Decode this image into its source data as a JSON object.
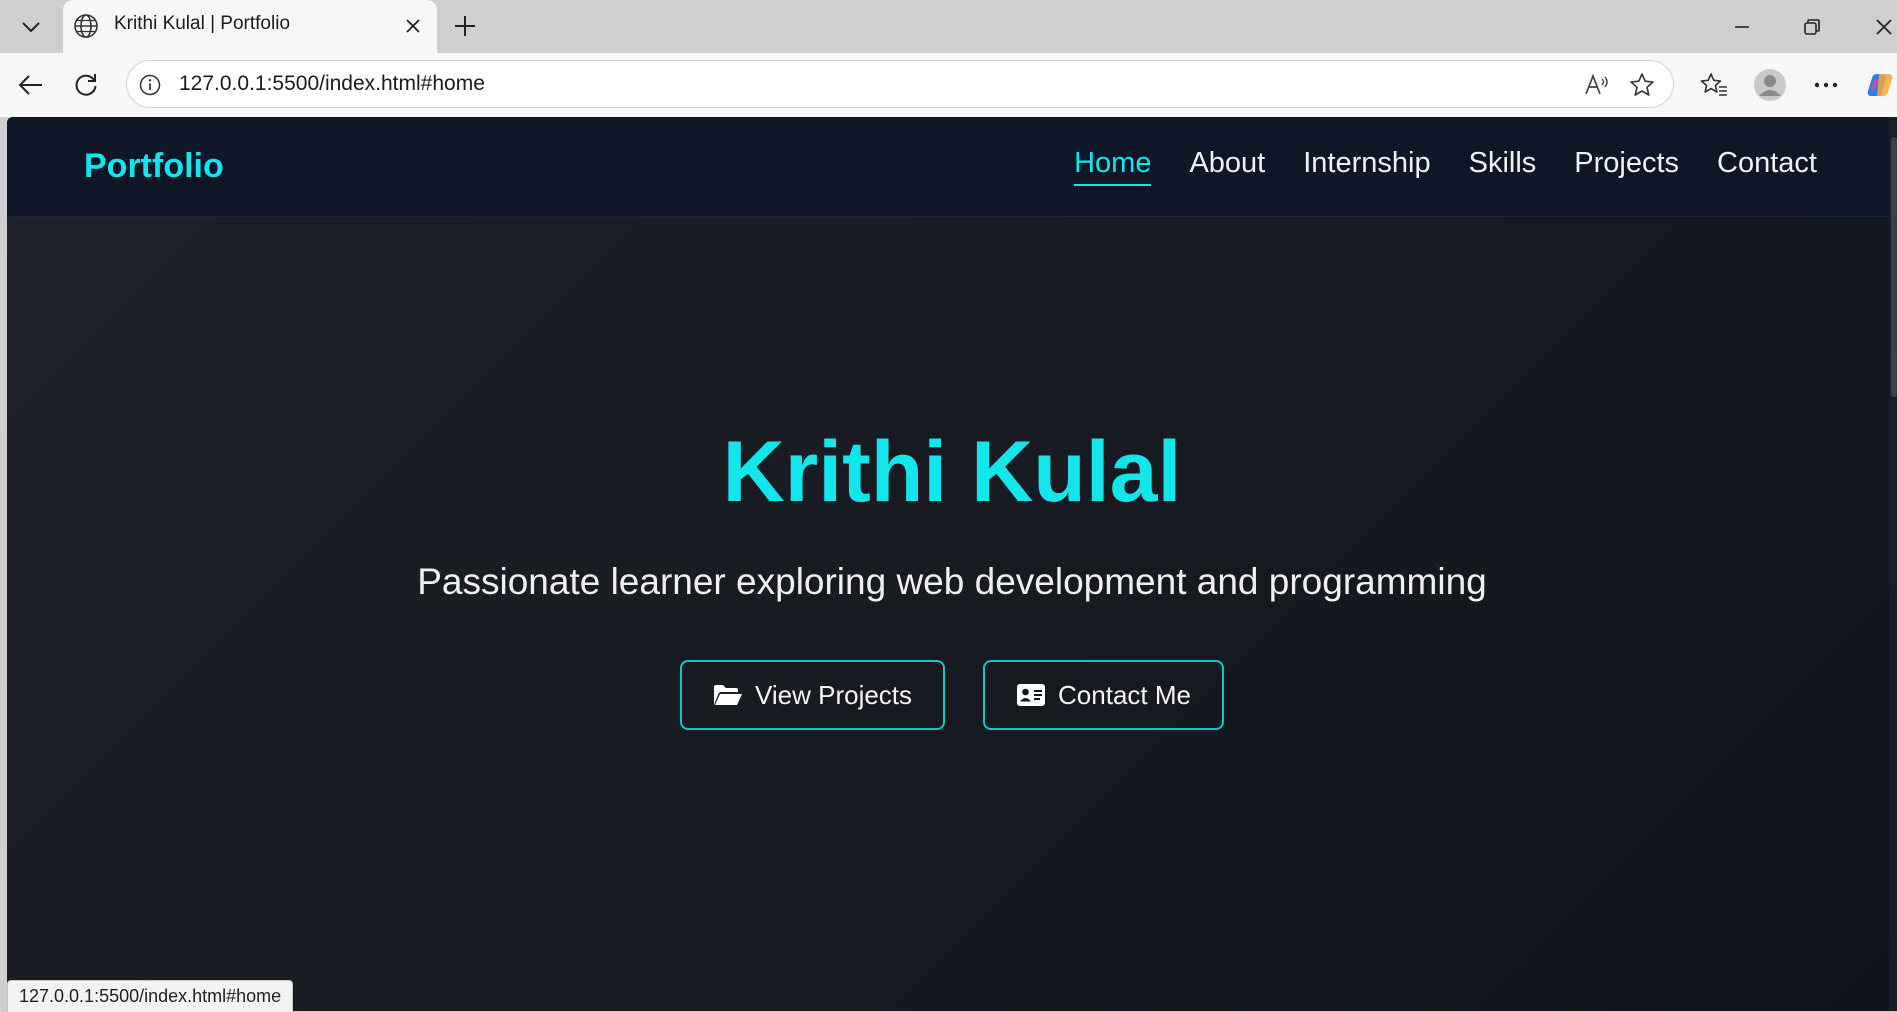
{
  "browser": {
    "tab": {
      "title": "Krithi Kulal | Portfolio"
    },
    "address": {
      "url": "127.0.0.1:5500/index.html#home"
    },
    "status_url": "127.0.0.1:5500/index.html#home"
  },
  "site": {
    "brand": "Portfolio",
    "nav": [
      {
        "label": "Home",
        "active": true
      },
      {
        "label": "About",
        "active": false
      },
      {
        "label": "Internship",
        "active": false
      },
      {
        "label": "Skills",
        "active": false
      },
      {
        "label": "Projects",
        "active": false
      },
      {
        "label": "Contact",
        "active": false
      }
    ],
    "hero": {
      "name": "Krithi Kulal",
      "tagline": "Passionate learner exploring web development and programming",
      "buttons": [
        {
          "label": "View Projects",
          "icon": "folder-open-icon"
        },
        {
          "label": "Contact Me",
          "icon": "address-card-icon"
        }
      ]
    }
  },
  "colors": {
    "accent": "#12e6ea",
    "nav_background": "#0f1627",
    "page_background": "#1a1d24"
  }
}
